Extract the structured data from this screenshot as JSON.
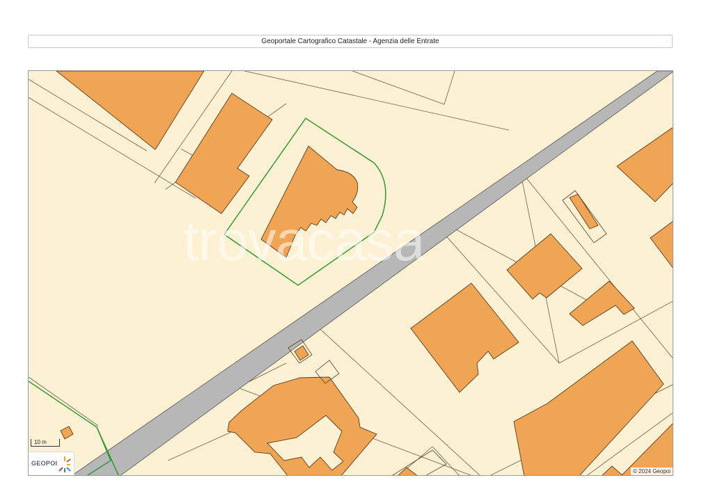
{
  "header": {
    "title": "Geoportale Cartografico Catastale - Agenzia delle Entrate",
    "dot": "."
  },
  "map": {
    "watermark": "trovacasa",
    "scale_label": "10 m",
    "logo_text": "GEOPOI",
    "copyright": "© 2024 Geopoi",
    "colors": {
      "parcel": "#fdf1d3",
      "building": "#f0a555",
      "building_stroke": "#5c3a1e",
      "road": "#b7b7b7",
      "parcel_line": "#6b5d4b",
      "highlight": "#2f9a36"
    }
  }
}
